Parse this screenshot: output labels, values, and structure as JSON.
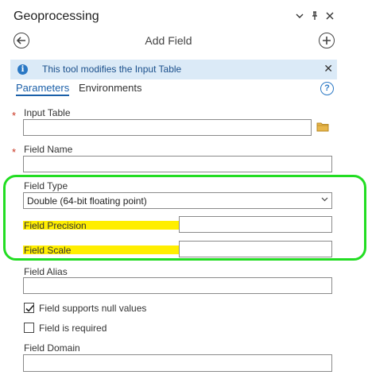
{
  "window": {
    "title": "Geoprocessing"
  },
  "titlebar_icons": [
    "chevron-down-icon",
    "pin-icon",
    "close-icon"
  ],
  "tool": {
    "title": "Add Field"
  },
  "banner": {
    "message": "This tool modifies the Input Table"
  },
  "tabs": [
    {
      "label": "Parameters",
      "active": true
    },
    {
      "label": "Environments",
      "active": false
    }
  ],
  "params": {
    "input_table": {
      "label": "Input Table",
      "value": ""
    },
    "field_name": {
      "label": "Field Name",
      "value": ""
    },
    "field_type": {
      "label": "Field Type",
      "value": "Double (64-bit floating point)"
    },
    "field_precision": {
      "label": "Field Precision",
      "value": ""
    },
    "field_scale": {
      "label": "Field Scale",
      "value": ""
    },
    "field_alias": {
      "label": "Field Alias",
      "value": ""
    },
    "null_values": {
      "label": "Field supports null values",
      "checked": true
    },
    "required": {
      "label": "Field is required",
      "checked": false
    },
    "field_domain": {
      "label": "Field Domain",
      "value": ""
    }
  },
  "colors": {
    "accent": "#1a5fa8",
    "required_star": "#c8321e",
    "banner_bg": "#dbeaf7",
    "highlight": "#ffee00",
    "annotation": "#22dd22"
  }
}
